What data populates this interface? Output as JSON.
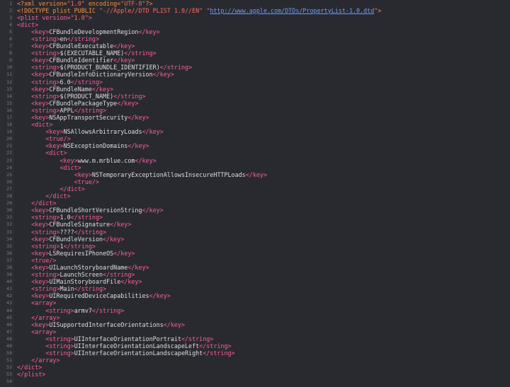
{
  "editor": {
    "language": "xml-plist",
    "colors": {
      "background": "#292a30",
      "tag": "#fc5fa3",
      "text": "#dfdfe0",
      "processing_instruction": "#fd8f3f",
      "string": "#fc6a5d",
      "link": "#6b9bff",
      "line_number": "#7b7c83"
    },
    "lines": [
      {
        "n": "1",
        "indent": "",
        "tokens": [
          {
            "t": "<?xml version=",
            "c": "pi"
          },
          {
            "t": "\"1.0\"",
            "c": "str"
          },
          {
            "t": " encoding=",
            "c": "pi"
          },
          {
            "t": "\"UTF-8\"",
            "c": "str"
          },
          {
            "t": "?>",
            "c": "pi"
          }
        ]
      },
      {
        "n": "2",
        "indent": "",
        "tokens": [
          {
            "t": "<!DOCTYPE plist PUBLIC ",
            "c": "pi"
          },
          {
            "t": "\"-//Apple//DTD PLIST 1.0//EN\"",
            "c": "str"
          },
          {
            "t": " ",
            "c": "pi"
          },
          {
            "t": "\"",
            "c": "str"
          },
          {
            "t": "http://www.apple.com/DTDs/PropertyList-1.0.dtd",
            "c": "url"
          },
          {
            "t": "\"",
            "c": "str"
          },
          {
            "t": ">",
            "c": "pi"
          }
        ]
      },
      {
        "n": "3",
        "indent": "",
        "tokens": [
          {
            "t": "<plist version=",
            "c": "tag"
          },
          {
            "t": "\"1.0\"",
            "c": "str"
          },
          {
            "t": ">",
            "c": "tag"
          }
        ]
      },
      {
        "n": "4",
        "indent": "",
        "tokens": [
          {
            "t": "<dict>",
            "c": "tag"
          }
        ]
      },
      {
        "n": "5",
        "indent": "    ",
        "tokens": [
          {
            "t": "<key>",
            "c": "tag"
          },
          {
            "t": "CFBundleDevelopmentRegion",
            "c": "txt"
          },
          {
            "t": "</key>",
            "c": "tag"
          }
        ]
      },
      {
        "n": "6",
        "indent": "    ",
        "tokens": [
          {
            "t": "<string>",
            "c": "tag"
          },
          {
            "t": "en",
            "c": "txt"
          },
          {
            "t": "</string>",
            "c": "tag"
          }
        ]
      },
      {
        "n": "7",
        "indent": "    ",
        "tokens": [
          {
            "t": "<key>",
            "c": "tag"
          },
          {
            "t": "CFBundleExecutable",
            "c": "txt"
          },
          {
            "t": "</key>",
            "c": "tag"
          }
        ]
      },
      {
        "n": "8",
        "indent": "    ",
        "tokens": [
          {
            "t": "<string>",
            "c": "tag"
          },
          {
            "t": "$(EXECUTABLE_NAME)",
            "c": "txt"
          },
          {
            "t": "</string>",
            "c": "tag"
          }
        ]
      },
      {
        "n": "9",
        "indent": "    ",
        "tokens": [
          {
            "t": "<key>",
            "c": "tag"
          },
          {
            "t": "CFBundleIdentifier",
            "c": "txt"
          },
          {
            "t": "</key>",
            "c": "tag"
          }
        ]
      },
      {
        "n": "10",
        "indent": "    ",
        "tokens": [
          {
            "t": "<string>",
            "c": "tag"
          },
          {
            "t": "$(PRODUCT_BUNDLE_IDENTIFIER)",
            "c": "txt"
          },
          {
            "t": "</string>",
            "c": "tag"
          }
        ]
      },
      {
        "n": "11",
        "indent": "    ",
        "tokens": [
          {
            "t": "<key>",
            "c": "tag"
          },
          {
            "t": "CFBundleInfoDictionaryVersion",
            "c": "txt"
          },
          {
            "t": "</key>",
            "c": "tag"
          }
        ]
      },
      {
        "n": "12",
        "indent": "    ",
        "tokens": [
          {
            "t": "<string>",
            "c": "tag"
          },
          {
            "t": "6.0",
            "c": "txt"
          },
          {
            "t": "</string>",
            "c": "tag"
          }
        ]
      },
      {
        "n": "13",
        "indent": "    ",
        "tokens": [
          {
            "t": "<key>",
            "c": "tag"
          },
          {
            "t": "CFBundleName",
            "c": "txt"
          },
          {
            "t": "</key>",
            "c": "tag"
          }
        ]
      },
      {
        "n": "14",
        "indent": "    ",
        "tokens": [
          {
            "t": "<string>",
            "c": "tag"
          },
          {
            "t": "$(PRODUCT_NAME)",
            "c": "txt"
          },
          {
            "t": "</string>",
            "c": "tag"
          }
        ]
      },
      {
        "n": "15",
        "indent": "    ",
        "tokens": [
          {
            "t": "<key>",
            "c": "tag"
          },
          {
            "t": "CFBundlePackageType",
            "c": "txt"
          },
          {
            "t": "</key>",
            "c": "tag"
          }
        ]
      },
      {
        "n": "16",
        "indent": "    ",
        "tokens": [
          {
            "t": "<string>",
            "c": "tag"
          },
          {
            "t": "APPL",
            "c": "txt"
          },
          {
            "t": "</string>",
            "c": "tag"
          }
        ]
      },
      {
        "n": "17",
        "indent": "    ",
        "tokens": [
          {
            "t": "<key>",
            "c": "tag"
          },
          {
            "t": "NSAppTransportSecurity",
            "c": "txt"
          },
          {
            "t": "</key>",
            "c": "tag"
          }
        ]
      },
      {
        "n": "18",
        "indent": "    ",
        "tokens": [
          {
            "t": "<dict>",
            "c": "tag"
          }
        ]
      },
      {
        "n": "19",
        "indent": "        ",
        "tokens": [
          {
            "t": "<key>",
            "c": "tag"
          },
          {
            "t": "NSAllowsArbitraryLoads",
            "c": "txt"
          },
          {
            "t": "</key>",
            "c": "tag"
          }
        ]
      },
      {
        "n": "20",
        "indent": "        ",
        "tokens": [
          {
            "t": "<true/>",
            "c": "tag"
          }
        ]
      },
      {
        "n": "21",
        "indent": "        ",
        "tokens": [
          {
            "t": "<key>",
            "c": "tag"
          },
          {
            "t": "NSExceptionDomains",
            "c": "txt"
          },
          {
            "t": "</key>",
            "c": "tag"
          }
        ]
      },
      {
        "n": "22",
        "indent": "        ",
        "tokens": [
          {
            "t": "<dict>",
            "c": "tag"
          }
        ]
      },
      {
        "n": "23",
        "indent": "            ",
        "tokens": [
          {
            "t": "<key>",
            "c": "tag"
          },
          {
            "t": "www.m.mrblue.com",
            "c": "txt"
          },
          {
            "t": "</key>",
            "c": "tag"
          }
        ]
      },
      {
        "n": "24",
        "indent": "            ",
        "tokens": [
          {
            "t": "<dict>",
            "c": "tag"
          }
        ]
      },
      {
        "n": "25",
        "indent": "                ",
        "tokens": [
          {
            "t": "<key>",
            "c": "tag"
          },
          {
            "t": "NSTemporaryExceptionAllowsInsecureHTTPLoads",
            "c": "txt"
          },
          {
            "t": "</key>",
            "c": "tag"
          }
        ]
      },
      {
        "n": "26",
        "indent": "                ",
        "tokens": [
          {
            "t": "<true/>",
            "c": "tag"
          }
        ]
      },
      {
        "n": "27",
        "indent": "            ",
        "tokens": [
          {
            "t": "</dict>",
            "c": "tag"
          }
        ]
      },
      {
        "n": "28",
        "indent": "        ",
        "tokens": [
          {
            "t": "</dict>",
            "c": "tag"
          }
        ]
      },
      {
        "n": "29",
        "indent": "    ",
        "tokens": [
          {
            "t": "</dict>",
            "c": "tag"
          }
        ]
      },
      {
        "n": "30",
        "indent": "    ",
        "tokens": [
          {
            "t": "<key>",
            "c": "tag"
          },
          {
            "t": "CFBundleShortVersionString",
            "c": "txt"
          },
          {
            "t": "</key>",
            "c": "tag"
          }
        ]
      },
      {
        "n": "31",
        "indent": "    ",
        "tokens": [
          {
            "t": "<string>",
            "c": "tag"
          },
          {
            "t": "1.0",
            "c": "txt"
          },
          {
            "t": "</string>",
            "c": "tag"
          }
        ]
      },
      {
        "n": "32",
        "indent": "    ",
        "tokens": [
          {
            "t": "<key>",
            "c": "tag"
          },
          {
            "t": "CFBundleSignature",
            "c": "txt"
          },
          {
            "t": "</key>",
            "c": "tag"
          }
        ]
      },
      {
        "n": "33",
        "indent": "    ",
        "tokens": [
          {
            "t": "<string>",
            "c": "tag"
          },
          {
            "t": "????",
            "c": "txt"
          },
          {
            "t": "</string>",
            "c": "tag"
          }
        ]
      },
      {
        "n": "34",
        "indent": "    ",
        "tokens": [
          {
            "t": "<key>",
            "c": "tag"
          },
          {
            "t": "CFBundleVersion",
            "c": "txt"
          },
          {
            "t": "</key>",
            "c": "tag"
          }
        ]
      },
      {
        "n": "35",
        "indent": "    ",
        "tokens": [
          {
            "t": "<string>",
            "c": "tag"
          },
          {
            "t": "1",
            "c": "txt"
          },
          {
            "t": "</string>",
            "c": "tag"
          }
        ]
      },
      {
        "n": "36",
        "indent": "    ",
        "tokens": [
          {
            "t": "<key>",
            "c": "tag"
          },
          {
            "t": "LSRequiresIPhoneOS",
            "c": "txt"
          },
          {
            "t": "</key>",
            "c": "tag"
          }
        ]
      },
      {
        "n": "37",
        "indent": "    ",
        "tokens": [
          {
            "t": "<true/>",
            "c": "tag"
          }
        ]
      },
      {
        "n": "38",
        "indent": "    ",
        "tokens": [
          {
            "t": "<key>",
            "c": "tag"
          },
          {
            "t": "UILaunchStoryboardName",
            "c": "txt"
          },
          {
            "t": "</key>",
            "c": "tag"
          }
        ]
      },
      {
        "n": "39",
        "indent": "    ",
        "tokens": [
          {
            "t": "<string>",
            "c": "tag"
          },
          {
            "t": "LaunchScreen",
            "c": "txt"
          },
          {
            "t": "</string>",
            "c": "tag"
          }
        ]
      },
      {
        "n": "40",
        "indent": "    ",
        "tokens": [
          {
            "t": "<key>",
            "c": "tag"
          },
          {
            "t": "UIMainStoryboardFile",
            "c": "txt"
          },
          {
            "t": "</key>",
            "c": "tag"
          }
        ]
      },
      {
        "n": "41",
        "indent": "    ",
        "tokens": [
          {
            "t": "<string>",
            "c": "tag"
          },
          {
            "t": "Main",
            "c": "txt"
          },
          {
            "t": "</string>",
            "c": "tag"
          }
        ]
      },
      {
        "n": "42",
        "indent": "    ",
        "tokens": [
          {
            "t": "<key>",
            "c": "tag"
          },
          {
            "t": "UIRequiredDeviceCapabilities",
            "c": "txt"
          },
          {
            "t": "</key>",
            "c": "tag"
          }
        ]
      },
      {
        "n": "43",
        "indent": "    ",
        "tokens": [
          {
            "t": "<array>",
            "c": "tag"
          }
        ]
      },
      {
        "n": "44",
        "indent": "        ",
        "tokens": [
          {
            "t": "<string>",
            "c": "tag"
          },
          {
            "t": "armv7",
            "c": "txt"
          },
          {
            "t": "</string>",
            "c": "tag"
          }
        ]
      },
      {
        "n": "45",
        "indent": "    ",
        "tokens": [
          {
            "t": "</array>",
            "c": "tag"
          }
        ]
      },
      {
        "n": "46",
        "indent": "    ",
        "tokens": [
          {
            "t": "<key>",
            "c": "tag"
          },
          {
            "t": "UISupportedInterfaceOrientations",
            "c": "txt"
          },
          {
            "t": "</key>",
            "c": "tag"
          }
        ]
      },
      {
        "n": "47",
        "indent": "    ",
        "tokens": [
          {
            "t": "<array>",
            "c": "tag"
          }
        ]
      },
      {
        "n": "48",
        "indent": "        ",
        "tokens": [
          {
            "t": "<string>",
            "c": "tag"
          },
          {
            "t": "UIInterfaceOrientationPortrait",
            "c": "txt"
          },
          {
            "t": "</string>",
            "c": "tag"
          }
        ]
      },
      {
        "n": "49",
        "indent": "        ",
        "tokens": [
          {
            "t": "<string>",
            "c": "tag"
          },
          {
            "t": "UIInterfaceOrientationLandscapeLeft",
            "c": "txt"
          },
          {
            "t": "</string>",
            "c": "tag"
          }
        ]
      },
      {
        "n": "50",
        "indent": "        ",
        "tokens": [
          {
            "t": "<string>",
            "c": "tag"
          },
          {
            "t": "UIInterfaceOrientationLandscapeRight",
            "c": "txt"
          },
          {
            "t": "</string>",
            "c": "tag"
          }
        ]
      },
      {
        "n": "51",
        "indent": "    ",
        "tokens": [
          {
            "t": "</array>",
            "c": "tag"
          }
        ]
      },
      {
        "n": "52",
        "indent": "",
        "tokens": [
          {
            "t": "</dict>",
            "c": "tag"
          }
        ]
      },
      {
        "n": "53",
        "indent": "",
        "tokens": [
          {
            "t": "</plist>",
            "c": "tag"
          }
        ]
      },
      {
        "n": "54",
        "indent": "",
        "tokens": []
      }
    ]
  }
}
